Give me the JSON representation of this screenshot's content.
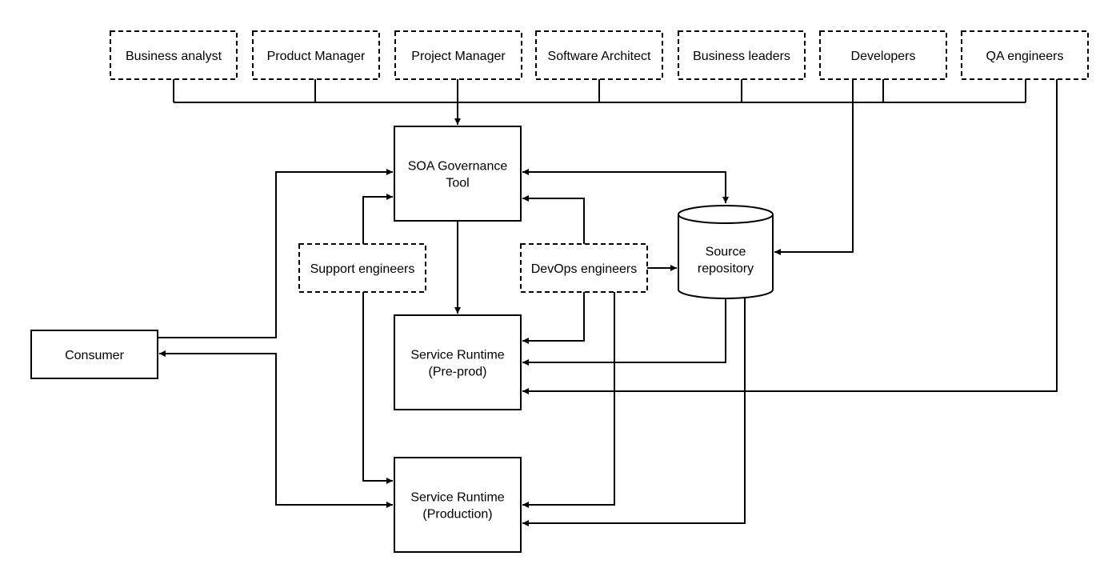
{
  "diagram": {
    "type": "flow",
    "roles": [
      {
        "id": "business-analyst",
        "label": "Business analyst"
      },
      {
        "id": "product-manager",
        "label": "Product Manager"
      },
      {
        "id": "project-manager",
        "label": "Project Manager"
      },
      {
        "id": "software-architect",
        "label": "Software Architect"
      },
      {
        "id": "business-leaders",
        "label": "Business leaders"
      },
      {
        "id": "developers",
        "label": "Developers"
      },
      {
        "id": "qa-engineers",
        "label": "QA engineers"
      }
    ],
    "nodes": {
      "soa_tool": {
        "lines": [
          "SOA Governance",
          "Tool"
        ]
      },
      "support": {
        "lines": [
          "Support engineers"
        ]
      },
      "devops": {
        "lines": [
          "DevOps engineers"
        ]
      },
      "repo": {
        "lines": [
          "Source",
          "repository"
        ]
      },
      "consumer": {
        "lines": [
          "Consumer"
        ]
      },
      "preprod": {
        "lines": [
          "Service Runtime",
          "(Pre-prod)"
        ]
      },
      "production": {
        "lines": [
          "Service Runtime",
          "(Production)"
        ]
      }
    },
    "edges": [
      {
        "from": "roles-bus",
        "to": "soa_tool"
      },
      {
        "from": "soa_tool",
        "to": "repo",
        "bidirectional": true
      },
      {
        "from": "developers",
        "to": "repo"
      },
      {
        "from": "consumer",
        "to": "soa_tool"
      },
      {
        "from": "support",
        "to": "soa_tool"
      },
      {
        "from": "devops",
        "to": "soa_tool"
      },
      {
        "from": "devops",
        "to": "repo"
      },
      {
        "from": "soa_tool",
        "to": "preprod"
      },
      {
        "from": "devops",
        "to": "preprod"
      },
      {
        "from": "repo",
        "to": "preprod"
      },
      {
        "from": "qa-engineers",
        "to": "preprod"
      },
      {
        "from": "production",
        "to": "consumer",
        "bidirectional": true
      },
      {
        "from": "support",
        "to": "production"
      },
      {
        "from": "devops",
        "to": "production"
      },
      {
        "from": "repo",
        "to": "production"
      }
    ]
  }
}
